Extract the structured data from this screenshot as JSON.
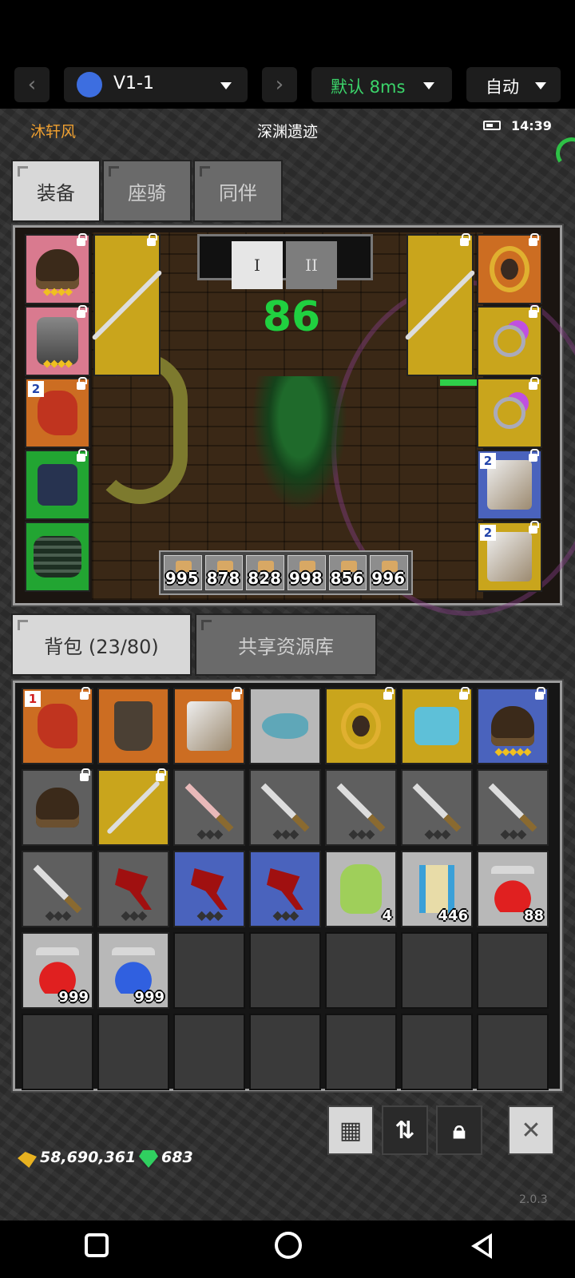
{
  "emulator": {
    "profile": "V1-1",
    "latency": "默认 8ms",
    "mode": "自动",
    "accent": "#3bd46a"
  },
  "status": {
    "player_name": "沐轩风",
    "location": "深渊遗迹",
    "time": "14:39"
  },
  "equip_tabs": [
    {
      "label": "装备",
      "active": true
    },
    {
      "label": "座骑",
      "active": false
    },
    {
      "label": "同伴",
      "active": false
    }
  ],
  "equip_sets": {
    "set1": "I",
    "set2": "II"
  },
  "hp_value": "86",
  "potion_bar": [
    "995",
    "878",
    "828",
    "998",
    "856",
    "996"
  ],
  "equipped": {
    "left_levels": {
      "gloves": "2"
    },
    "right_levels": {
      "companion1": "2",
      "companion2": "2"
    }
  },
  "bag_tabs": [
    {
      "label": "背包 (23/80)",
      "active": true
    },
    {
      "label": "共享资源库",
      "active": false
    }
  ],
  "bag": {
    "badges": {
      "gloves_level": "1",
      "bag_count": "4",
      "scroll_count": "446",
      "potion_red_small": "88",
      "potion_red": "999",
      "potion_blue": "999"
    }
  },
  "currency": {
    "gold": "58,690,361",
    "gems": "683"
  },
  "version": "2.0.3",
  "icons": [
    "android-icon",
    "grid-icon",
    "sort-icon",
    "lock-icon",
    "close-icon"
  ]
}
